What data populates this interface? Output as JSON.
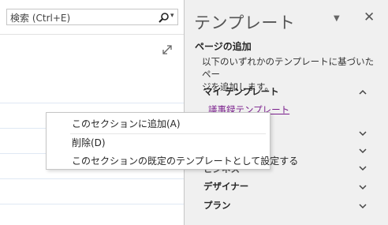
{
  "search": {
    "placeholder": "検索 (Ctrl+E)"
  },
  "pane": {
    "title": "テンプレート",
    "section_heading": "ページの追加",
    "description_line1": "以下のいずれかのテンプレートに基づいたペー",
    "description_line2": "ジを追加します。",
    "my_templates_label": "マイ テンプレート",
    "link_label": "議事録テンプレート",
    "hidden_row_label": "ビジネス",
    "designer_label": "デザイナー",
    "plan_label": "プラン"
  },
  "context_menu": {
    "items": [
      {
        "label": "このセクションに追加(A)"
      },
      {
        "label": "削除(D)"
      },
      {
        "label": "このセクションの既定のテンプレートとして設定する"
      }
    ]
  },
  "colors": {
    "accent": "#7a1f8c",
    "pane_bg": "#f0f0f0"
  }
}
